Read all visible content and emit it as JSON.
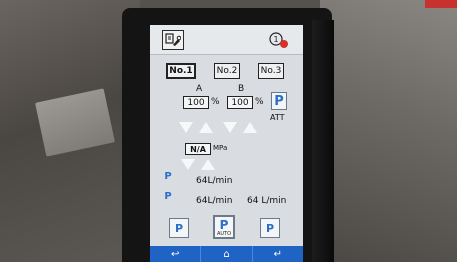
{
  "colors": {
    "screen_bg": "#d9dde1",
    "nav_bar": "#1f63c4",
    "accent_blue": "#2a6fc9",
    "alarm_red": "#d3312c"
  },
  "header": {
    "tool_icon": "wrench-settings-icon",
    "alarm_icon": "alarm-bell-icon"
  },
  "tabs": [
    {
      "label": "No.1",
      "active": true
    },
    {
      "label": "No.2",
      "active": false
    },
    {
      "label": "No.3",
      "active": false
    }
  ],
  "channels": {
    "a": {
      "label": "A",
      "value": "100",
      "unit": "%"
    },
    "b": {
      "label": "B",
      "value": "100",
      "unit": "%"
    }
  },
  "att_label": "ATT",
  "pressure": {
    "value": "N/A",
    "unit": "MPa"
  },
  "flow": {
    "row1": "64L/min",
    "row2_left": "64L/min",
    "row2_right": "64 L/min"
  },
  "mode_buttons": {
    "auto_label": "AUTO"
  },
  "nav": {
    "back": "↩",
    "home": "⌂",
    "enter": "↵"
  }
}
